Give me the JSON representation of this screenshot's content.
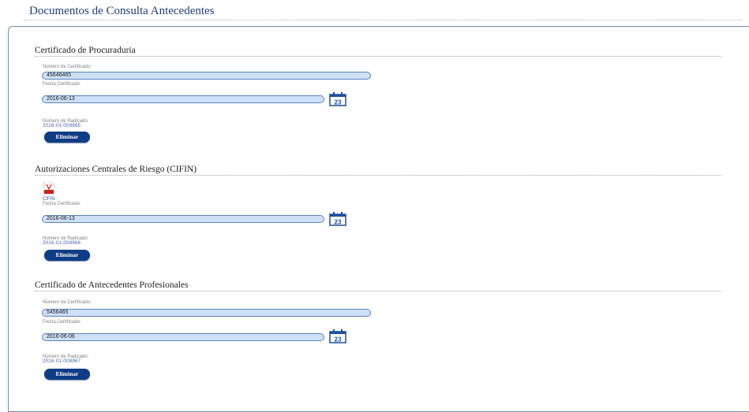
{
  "page": {
    "title": "Documentos de Consulta Antecedentes"
  },
  "sections": [
    {
      "title": "Certificado de Procuraduria",
      "cert_label": "Número de Certificado:",
      "cert_value": "45646465",
      "date_label": "Fecha Certificado:",
      "date_value": "2016-06-13",
      "calendar_day": "23",
      "radicado_label": "Número de Radicado:",
      "radicado_value": "2016-01-008965",
      "delete_label": "Eliminar"
    },
    {
      "title": "Autorizaciones Centrales de Riesgo (CIFIN)",
      "file_label": "CIFIN",
      "date_label": "Fecha Certificado:",
      "date_value": "2016-06-13",
      "calendar_day": "23",
      "radicado_label": "Número de Radicado:",
      "radicado_value": "2016-01-008966",
      "delete_label": "Eliminar"
    },
    {
      "title": "Certificado de Antecedentes Profesionales",
      "cert_label": "Número de Certificado:",
      "cert_value": "5456465",
      "date_label": "Fecha Certificado:",
      "date_value": "2016-06-06",
      "calendar_day": "23",
      "radicado_label": "Número de Radicado:",
      "radicado_value": "2016-01-008967",
      "delete_label": "Eliminar"
    }
  ],
  "icons": {
    "calendar": "calendar-icon",
    "pdf": "pdf-file-icon"
  },
  "colors": {
    "accent": "#0f3c86",
    "field_bg": "#cde0f7",
    "field_border": "#5f84bd",
    "title": "#1f3f7a"
  }
}
